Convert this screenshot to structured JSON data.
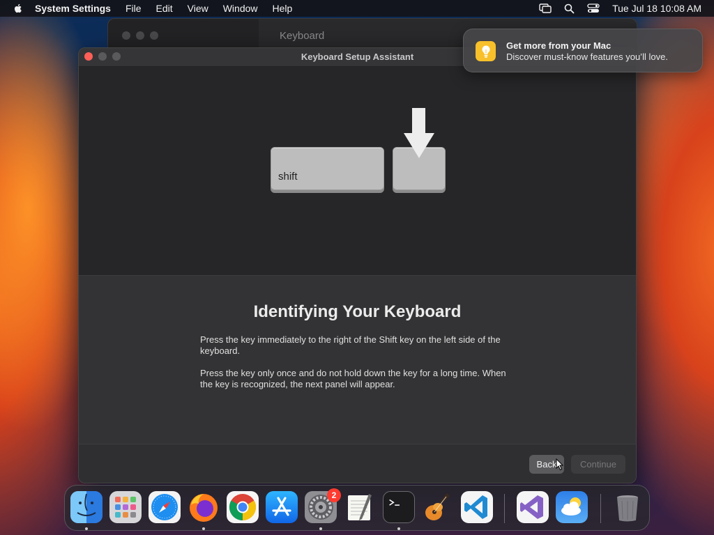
{
  "menubar": {
    "apple_icon": "apple-icon",
    "app_name": "System Settings",
    "items": [
      "File",
      "Edit",
      "View",
      "Window",
      "Help"
    ],
    "status_icons": [
      "screen-mirroring-icon",
      "search-icon",
      "control-center-icon"
    ],
    "clock": "Tue Jul 18  10:08 AM"
  },
  "background_window": {
    "title": "Keyboard"
  },
  "dialog": {
    "title": "Keyboard Setup Assistant",
    "illustration": {
      "shift_key_label": "shift",
      "arrow_icon": "down-arrow-icon"
    },
    "heading": "Identifying Your Keyboard",
    "paragraph1": "Press the key immediately to the right of the Shift key on the left side of the keyboard.",
    "paragraph2": "Press the key only once and do not hold down the key for a long time. When the key is recognized, the next panel will appear.",
    "back_label": "Back",
    "continue_label": "Continue"
  },
  "notification": {
    "icon": "lightbulb-icon",
    "title": "Get more from your Mac",
    "body": "Discover must-know features you’ll love.",
    "accent": "#f8c02a"
  },
  "dock": {
    "items": [
      {
        "name": "Finder",
        "icon": "finder-icon",
        "running": true
      },
      {
        "name": "Launchpad",
        "icon": "launchpad-icon",
        "running": false
      },
      {
        "name": "Safari",
        "icon": "safari-icon",
        "running": false
      },
      {
        "name": "Firefox",
        "icon": "firefox-icon",
        "running": true
      },
      {
        "name": "Google Chrome",
        "icon": "chrome-icon",
        "running": false
      },
      {
        "name": "App Store",
        "icon": "app-store-icon",
        "running": false
      },
      {
        "name": "System Settings",
        "icon": "system-settings-icon",
        "running": true,
        "badge": "2"
      },
      {
        "name": "TextEdit",
        "icon": "textedit-icon",
        "running": false
      },
      {
        "name": "Terminal",
        "icon": "terminal-icon",
        "running": true
      },
      {
        "name": "GarageBand",
        "icon": "garageband-icon",
        "running": false
      },
      {
        "name": "Visual Studio Code",
        "icon": "vscode-icon",
        "running": false
      },
      {
        "name": "Visual Studio",
        "icon": "visual-studio-icon",
        "running": false
      },
      {
        "name": "Weather",
        "icon": "weather-icon",
        "running": false
      },
      {
        "name": "Trash",
        "icon": "trash-icon",
        "running": false
      }
    ]
  }
}
